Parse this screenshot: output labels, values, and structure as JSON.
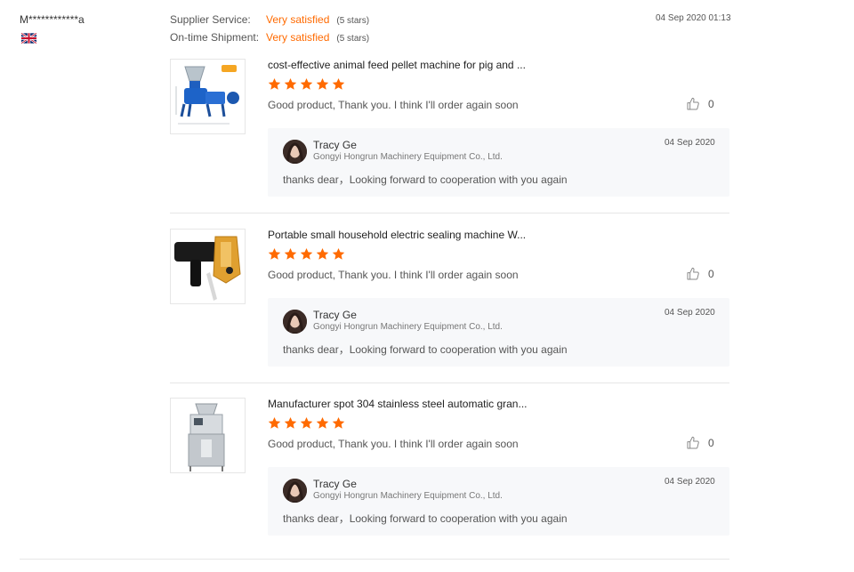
{
  "reviewer": {
    "name": "M************a",
    "flag_icon": "uk-flag-icon"
  },
  "ratings": {
    "supplier_service": {
      "label": "Supplier Service:",
      "value": "Very satisfied",
      "note": "(5 stars)"
    },
    "on_time_shipment": {
      "label": "On-time Shipment:",
      "value": "Very satisfied",
      "note": "(5 stars)"
    }
  },
  "review_date": "04 Sep 2020 01:13",
  "colors": {
    "accent": "#ff6a00",
    "star": "#ff6a00",
    "reply_bg": "#f7f8fa"
  },
  "reviews": [
    {
      "product_title": "cost-effective animal feed pellet machine for pig and ...",
      "stars": 5,
      "text": "Good product, Thank you. I think I'll order again soon",
      "likes": "0",
      "reply": {
        "name": "Tracy Ge",
        "company": "Gongyi Hongrun Machinery Equipment Co., Ltd.",
        "date": "04 Sep 2020",
        "text": "thanks dear，Looking forward to cooperation with you again"
      }
    },
    {
      "product_title": "Portable small household electric sealing machine W...",
      "stars": 5,
      "text": "Good product, Thank you. I think I'll order again soon",
      "likes": "0",
      "reply": {
        "name": "Tracy Ge",
        "company": "Gongyi Hongrun Machinery Equipment Co., Ltd.",
        "date": "04 Sep 2020",
        "text": "thanks dear，Looking forward to cooperation with you again"
      }
    },
    {
      "product_title": "Manufacturer spot 304 stainless steel automatic gran...",
      "stars": 5,
      "text": "Good product, Thank you. I think I'll order again soon",
      "likes": "0",
      "reply": {
        "name": "Tracy Ge",
        "company": "Gongyi Hongrun Machinery Equipment Co., Ltd.",
        "date": "04 Sep 2020",
        "text": "thanks dear，Looking forward to cooperation with you again"
      }
    }
  ]
}
